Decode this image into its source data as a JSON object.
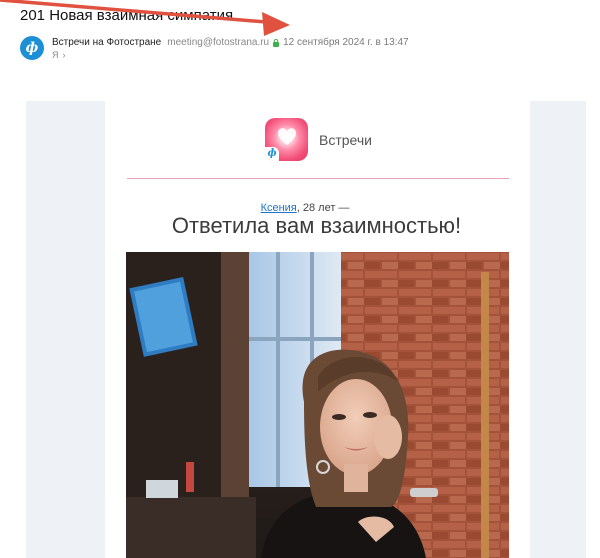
{
  "email": {
    "subject": "201 Новая взаимная симпатия",
    "sender": {
      "avatar_letter": "ф",
      "name": "Встречи на Фотостране",
      "email": "meeting@fotostrana.ru",
      "date": "12 сентября 2024 г. в 13:47",
      "recipient": "Я",
      "recipient_chevron": "›"
    }
  },
  "body": {
    "app_title": "Встречи",
    "app_badge_letter": "ф",
    "profile_name": "Ксения",
    "profile_age": ", 28 лет —",
    "headline": "Ответила вам взаимностью!"
  },
  "colors": {
    "accent_link": "#1d74c9",
    "brand_blue": "#1d8fd6",
    "brand_pink": "#e5365f",
    "annotation_arrow": "#e0523f"
  }
}
